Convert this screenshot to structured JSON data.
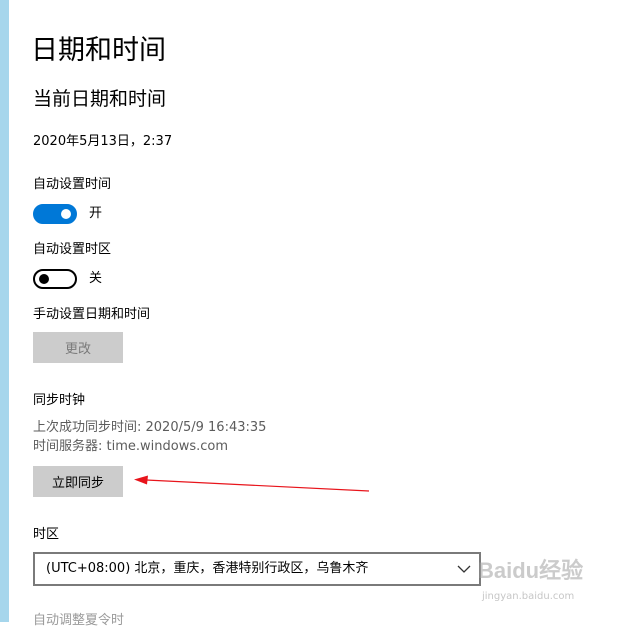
{
  "page_title": "日期和时间",
  "current": {
    "section_title": "当前日期和时间",
    "datetime_text": "2020年5月13日，2:37"
  },
  "auto_time": {
    "label": "自动设置时间",
    "state_text": "开",
    "enabled": true
  },
  "auto_timezone": {
    "label": "自动设置时区",
    "state_text": "关",
    "enabled": false
  },
  "manual": {
    "label": "手动设置日期和时间",
    "change_button": "更改"
  },
  "sync": {
    "label": "同步时钟",
    "last_sync": "上次成功同步时间: 2020/5/9 16:43:35",
    "server": "时间服务器: time.windows.com",
    "sync_button": "立即同步"
  },
  "timezone": {
    "label": "时区",
    "selected": "(UTC+08:00) 北京，重庆，香港特别行政区，乌鲁木齐"
  },
  "next_section_partial": "自动调整夏令时",
  "watermark": {
    "logo": "Baidu经验",
    "url": "jingyan.baidu.com"
  },
  "colors": {
    "accent": "#0078d7",
    "annotation_arrow": "#e8141b",
    "window_strip": "#a6d6ec"
  },
  "icons": {
    "dropdown": "chevron-down-icon",
    "annotation": "red-arrow-icon"
  }
}
